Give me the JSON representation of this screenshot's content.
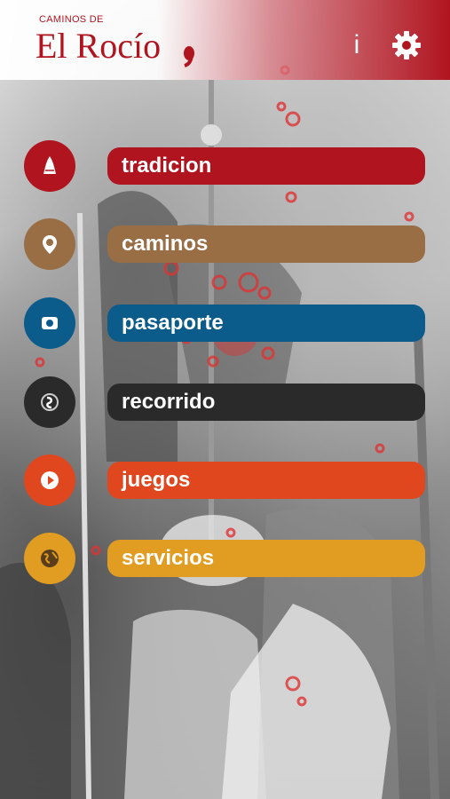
{
  "header": {
    "logo_small": "CAMINOS DE",
    "logo_big": "El Rocío",
    "info_label": "i"
  },
  "colors": {
    "brand_red": "#b0141f",
    "tradicion": "#b0141f",
    "caminos": "#9a6e45",
    "pasaporte": "#0b5b8b",
    "recorrido": "#2a2a2a",
    "juegos": "#e0471f",
    "servicios": "#e19d22"
  },
  "menu": [
    {
      "label": "tradicion",
      "icon": "bell-icon"
    },
    {
      "label": "caminos",
      "icon": "location-pin-icon"
    },
    {
      "label": "pasaporte",
      "icon": "passport-icon"
    },
    {
      "label": "recorrido",
      "icon": "route-icon"
    },
    {
      "label": "juegos",
      "icon": "play-icon"
    },
    {
      "label": "servicios",
      "icon": "globe-icon"
    }
  ]
}
